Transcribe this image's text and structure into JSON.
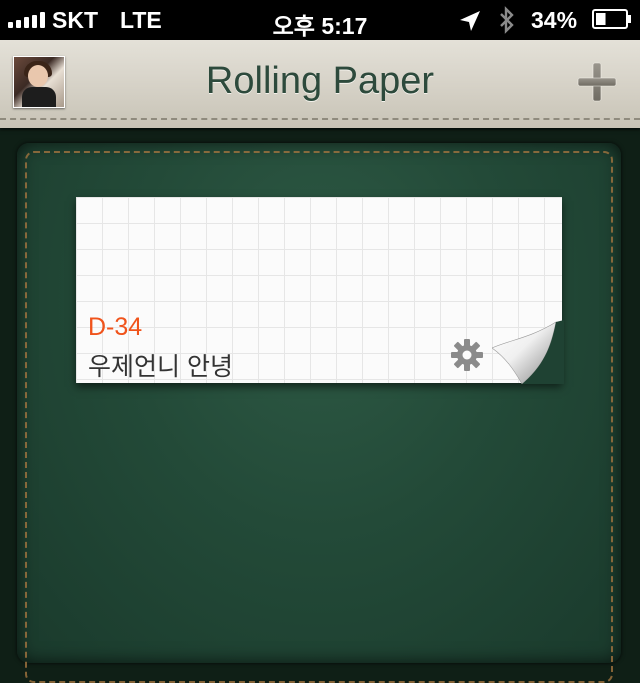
{
  "status_bar": {
    "carrier": "SKT",
    "network": "LTE",
    "time": "오후 5:17",
    "battery_percent": "34%",
    "battery_level": 0.34,
    "signal_bars": 5,
    "icons": [
      "location-icon",
      "bluetooth-icon",
      "battery-icon"
    ]
  },
  "nav_bar": {
    "title": "Rolling Paper",
    "left_button": "profile-avatar",
    "right_button": "add-icon"
  },
  "notes": [
    {
      "d_day": "D-34",
      "title": "우제언니 안녕",
      "settings_icon": "gear-icon"
    }
  ],
  "colors": {
    "accent": "#f0531b",
    "title": "#2d4a3c",
    "board": "#234a38",
    "nav_bar": "#d5d1c6"
  }
}
